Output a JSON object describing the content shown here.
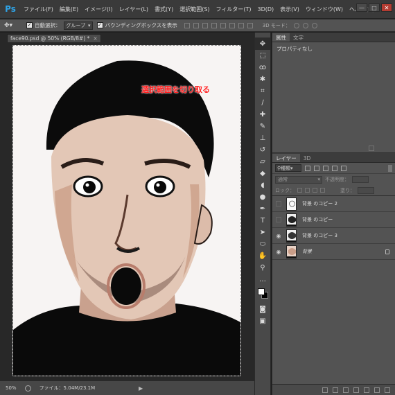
{
  "app": {
    "logo": "Ps"
  },
  "menu": [
    "ファイル(F)",
    "編集(E)",
    "イメージ(I)",
    "レイヤー(L)",
    "書式(Y)",
    "選択範囲(S)",
    "フィルター(T)",
    "3D(D)",
    "表示(V)",
    "ウィンドウ(W)",
    "ヘルプ(H)"
  ],
  "window_controls": {
    "minimize": "—",
    "maximize": "□",
    "close": "✕"
  },
  "options": {
    "tool_icon": "move-tool-icon",
    "auto_select_label": "自動選択：",
    "auto_select_value": "グループ",
    "bounding_box_label": "バウンディングボックスを表示",
    "mode3d_label": "3D モード："
  },
  "document": {
    "tab_title": "face90.psd @ 50% (RGB/8#) *",
    "tab_close": "×",
    "overlay_text": "選択範囲を切り取る",
    "accent_color": "#ff1e1e"
  },
  "status": {
    "zoom": "50%",
    "file_info": "ファイル：5.04M/23.1M",
    "arrow": "▶"
  },
  "properties": {
    "tabs": [
      "属性",
      "文字"
    ],
    "content": "プロパティなし"
  },
  "layers": {
    "tabs": [
      "レイヤー",
      "3D"
    ],
    "kind_label": "種類",
    "blend_mode": "通常",
    "opacity_label": "不透明度：",
    "lock_label": "ロック：",
    "fill_label": "塗り：",
    "items": [
      {
        "name": "背景 のコピー 2",
        "visible": false
      },
      {
        "name": "背景 のコピー",
        "visible": false
      },
      {
        "name": "背景 のコピー 3",
        "visible": true
      },
      {
        "name": "背景",
        "visible": true
      }
    ]
  }
}
